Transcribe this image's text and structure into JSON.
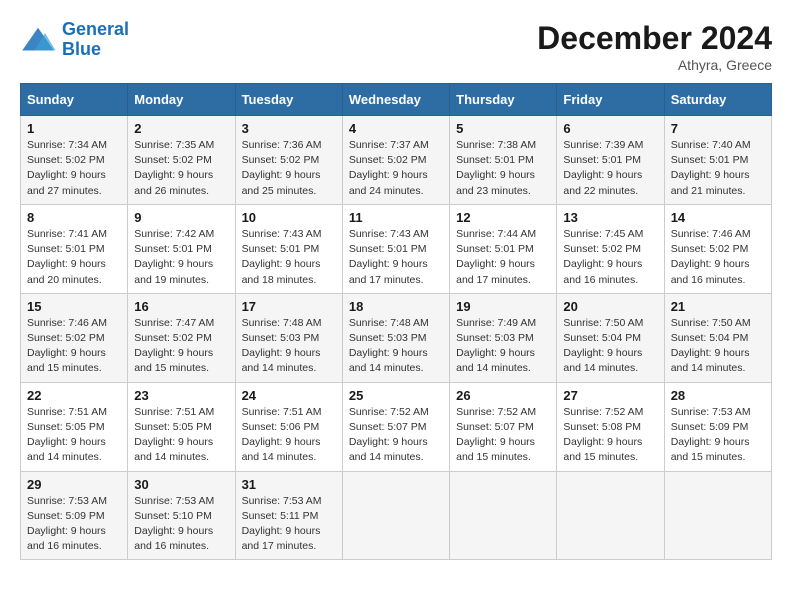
{
  "header": {
    "logo_line1": "General",
    "logo_line2": "Blue",
    "month_title": "December 2024",
    "location": "Athyra, Greece"
  },
  "weekdays": [
    "Sunday",
    "Monday",
    "Tuesday",
    "Wednesday",
    "Thursday",
    "Friday",
    "Saturday"
  ],
  "weeks": [
    [
      {
        "day": "1",
        "sunrise": "7:34 AM",
        "sunset": "5:02 PM",
        "daylight": "9 hours and 27 minutes."
      },
      {
        "day": "2",
        "sunrise": "7:35 AM",
        "sunset": "5:02 PM",
        "daylight": "9 hours and 26 minutes."
      },
      {
        "day": "3",
        "sunrise": "7:36 AM",
        "sunset": "5:02 PM",
        "daylight": "9 hours and 25 minutes."
      },
      {
        "day": "4",
        "sunrise": "7:37 AM",
        "sunset": "5:02 PM",
        "daylight": "9 hours and 24 minutes."
      },
      {
        "day": "5",
        "sunrise": "7:38 AM",
        "sunset": "5:01 PM",
        "daylight": "9 hours and 23 minutes."
      },
      {
        "day": "6",
        "sunrise": "7:39 AM",
        "sunset": "5:01 PM",
        "daylight": "9 hours and 22 minutes."
      },
      {
        "day": "7",
        "sunrise": "7:40 AM",
        "sunset": "5:01 PM",
        "daylight": "9 hours and 21 minutes."
      }
    ],
    [
      {
        "day": "8",
        "sunrise": "7:41 AM",
        "sunset": "5:01 PM",
        "daylight": "9 hours and 20 minutes."
      },
      {
        "day": "9",
        "sunrise": "7:42 AM",
        "sunset": "5:01 PM",
        "daylight": "9 hours and 19 minutes."
      },
      {
        "day": "10",
        "sunrise": "7:43 AM",
        "sunset": "5:01 PM",
        "daylight": "9 hours and 18 minutes."
      },
      {
        "day": "11",
        "sunrise": "7:43 AM",
        "sunset": "5:01 PM",
        "daylight": "9 hours and 17 minutes."
      },
      {
        "day": "12",
        "sunrise": "7:44 AM",
        "sunset": "5:01 PM",
        "daylight": "9 hours and 17 minutes."
      },
      {
        "day": "13",
        "sunrise": "7:45 AM",
        "sunset": "5:02 PM",
        "daylight": "9 hours and 16 minutes."
      },
      {
        "day": "14",
        "sunrise": "7:46 AM",
        "sunset": "5:02 PM",
        "daylight": "9 hours and 16 minutes."
      }
    ],
    [
      {
        "day": "15",
        "sunrise": "7:46 AM",
        "sunset": "5:02 PM",
        "daylight": "9 hours and 15 minutes."
      },
      {
        "day": "16",
        "sunrise": "7:47 AM",
        "sunset": "5:02 PM",
        "daylight": "9 hours and 15 minutes."
      },
      {
        "day": "17",
        "sunrise": "7:48 AM",
        "sunset": "5:03 PM",
        "daylight": "9 hours and 14 minutes."
      },
      {
        "day": "18",
        "sunrise": "7:48 AM",
        "sunset": "5:03 PM",
        "daylight": "9 hours and 14 minutes."
      },
      {
        "day": "19",
        "sunrise": "7:49 AM",
        "sunset": "5:03 PM",
        "daylight": "9 hours and 14 minutes."
      },
      {
        "day": "20",
        "sunrise": "7:50 AM",
        "sunset": "5:04 PM",
        "daylight": "9 hours and 14 minutes."
      },
      {
        "day": "21",
        "sunrise": "7:50 AM",
        "sunset": "5:04 PM",
        "daylight": "9 hours and 14 minutes."
      }
    ],
    [
      {
        "day": "22",
        "sunrise": "7:51 AM",
        "sunset": "5:05 PM",
        "daylight": "9 hours and 14 minutes."
      },
      {
        "day": "23",
        "sunrise": "7:51 AM",
        "sunset": "5:05 PM",
        "daylight": "9 hours and 14 minutes."
      },
      {
        "day": "24",
        "sunrise": "7:51 AM",
        "sunset": "5:06 PM",
        "daylight": "9 hours and 14 minutes."
      },
      {
        "day": "25",
        "sunrise": "7:52 AM",
        "sunset": "5:07 PM",
        "daylight": "9 hours and 14 minutes."
      },
      {
        "day": "26",
        "sunrise": "7:52 AM",
        "sunset": "5:07 PM",
        "daylight": "9 hours and 15 minutes."
      },
      {
        "day": "27",
        "sunrise": "7:52 AM",
        "sunset": "5:08 PM",
        "daylight": "9 hours and 15 minutes."
      },
      {
        "day": "28",
        "sunrise": "7:53 AM",
        "sunset": "5:09 PM",
        "daylight": "9 hours and 15 minutes."
      }
    ],
    [
      {
        "day": "29",
        "sunrise": "7:53 AM",
        "sunset": "5:09 PM",
        "daylight": "9 hours and 16 minutes."
      },
      {
        "day": "30",
        "sunrise": "7:53 AM",
        "sunset": "5:10 PM",
        "daylight": "9 hours and 16 minutes."
      },
      {
        "day": "31",
        "sunrise": "7:53 AM",
        "sunset": "5:11 PM",
        "daylight": "9 hours and 17 minutes."
      },
      null,
      null,
      null,
      null
    ]
  ]
}
